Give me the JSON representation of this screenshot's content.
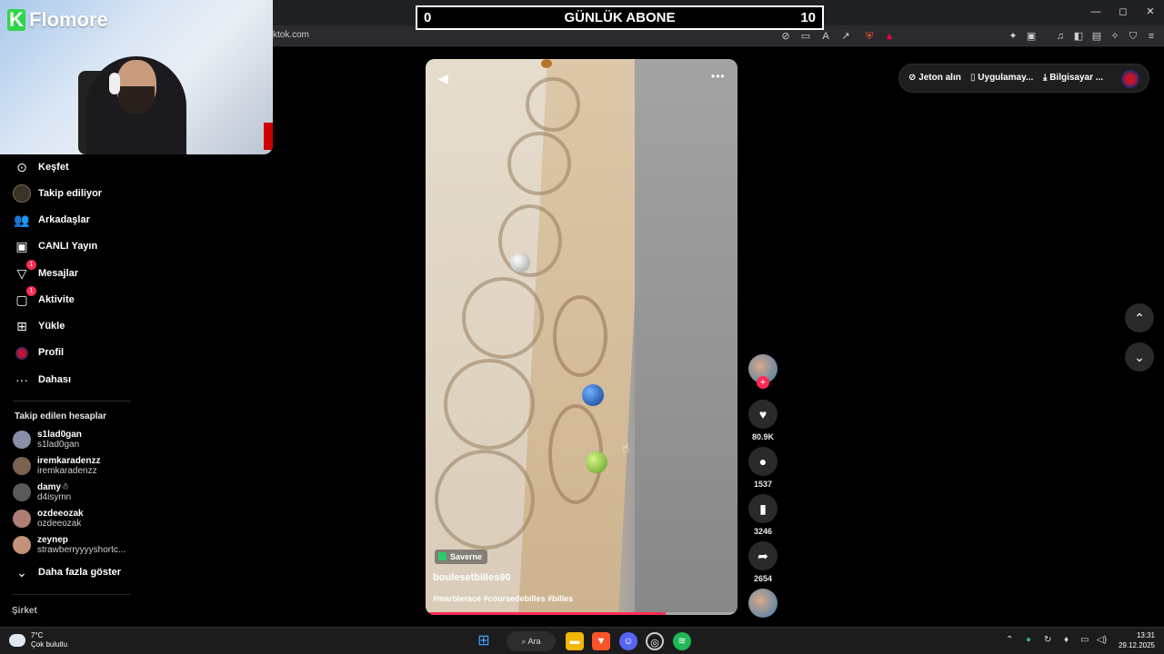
{
  "browser": {
    "url": "ktok.com",
    "window_controls": {
      "minimize": "—",
      "maximize": "◻",
      "close": "✕"
    }
  },
  "counter": {
    "left_value": "0",
    "title": "GÜNLÜK ABONE",
    "right_value": "10"
  },
  "overlay": {
    "brand_letter": "K",
    "brand_name": "Flomore"
  },
  "sidebar": {
    "items": [
      {
        "label": "Keşfet",
        "icon": "compass-icon"
      },
      {
        "label": "Takip ediliyor",
        "icon": "avatar-icon"
      },
      {
        "label": "Arkadaşlar",
        "icon": "friends-icon"
      },
      {
        "label": "CANLI Yayın",
        "icon": "live-tv-icon"
      },
      {
        "label": "Mesajlar",
        "icon": "send-icon",
        "badge": "1"
      },
      {
        "label": "Aktivite",
        "icon": "activity-icon",
        "badge": "1"
      },
      {
        "label": "Yükle",
        "icon": "upload-icon"
      },
      {
        "label": "Profil",
        "icon": "profile-avatar-icon"
      },
      {
        "label": "Dahası",
        "icon": "more-icon"
      }
    ],
    "following_title": "Takip edilen hesaplar",
    "accounts": [
      {
        "name": "s1lad0gan",
        "handle": "s1lad0gan",
        "color": "#8a8fa8"
      },
      {
        "name": "iremkaradenzz",
        "handle": "iremkaradenzz",
        "color": "#7a6250"
      },
      {
        "name": "damy☃",
        "handle": "d4isymn",
        "color": "#5a5a5a"
      },
      {
        "name": "ozdeeozak",
        "handle": "ozdeeozak",
        "color": "#b07f74"
      },
      {
        "name": "zeynep",
        "handle": "strawberryyyyshortc...",
        "color": "#c4927a"
      }
    ],
    "show_more": "Daha fazla göster",
    "company_title": "Şirket"
  },
  "top_actions": {
    "coins": "Jeton alın",
    "app": "Uygulamay...",
    "desktop": "Bilgisayar ..."
  },
  "video": {
    "location": "Saverne",
    "author": "boulesetbilles90",
    "caption": "#marblerace #coursedebilles #billes",
    "progress": 0.77
  },
  "actions": {
    "likes": "80.9K",
    "comments": "1537",
    "saves": "3246",
    "shares": "2654"
  },
  "taskbar": {
    "temp": "7°C",
    "weather": "Çok bulutlu",
    "search": "Ara",
    "time": "13:31",
    "date": "29.12.2025"
  }
}
